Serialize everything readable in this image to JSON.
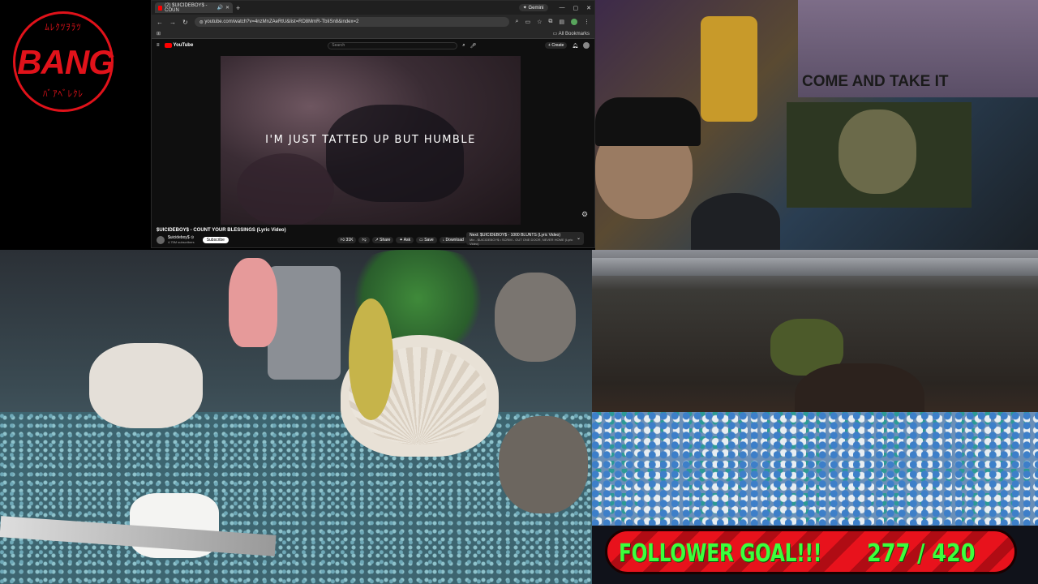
{
  "logo": {
    "word": "BANG",
    "top_text": "ﾑﾚｸﾂｦﾗﾂ",
    "bottom_text": "ﾊﾞｱﾍﾞﾚｸﾚ"
  },
  "browser": {
    "tab_title": "(2) $UICIDEBOY$ - COUN",
    "new_tab": "+",
    "gemini_label": "Gemini",
    "url": "youtube.com/watch?v=4nzMnZAeRtU&list=RD8MmR-TbIiSn8&index=2",
    "all_bookmarks": "All Bookmarks"
  },
  "youtube": {
    "brand": "YouTube",
    "search_placeholder": "Search",
    "create_label": "Create",
    "lyric_caption": "I'M JUST TATTED UP BUT HUMBLE",
    "video_title": "$UICIDEBOY$ - COUNT YOUR BLESSINGS (Lyric Video)",
    "channel_name": "$uicideboy$ ⊙",
    "channel_subs": "4.75M subscribers",
    "subscribe_label": "Subscribe",
    "actions": {
      "likes": "31K",
      "share": "Share",
      "ask": "Ask",
      "save": "Save",
      "download": "Download",
      "more": "···"
    },
    "next_title": "Next: $UICIDEBOY$ - 1000 BLUNTS (Lyric Video)",
    "next_sub": "Mix - $UICIDEBOY$ • SCRIM - OUT ONE DOOR, NEVER HOME (Lyric Video)"
  },
  "webcam": {
    "banner_text": "COME AND TAKE IT"
  },
  "goal": {
    "label": "FOLLOWER GOAL!!!",
    "current": "277",
    "separator": " / ",
    "target": "420"
  },
  "colors": {
    "accent_red": "#e8121c",
    "goal_green": "#3cff3c",
    "yt_red": "#ff0000"
  }
}
